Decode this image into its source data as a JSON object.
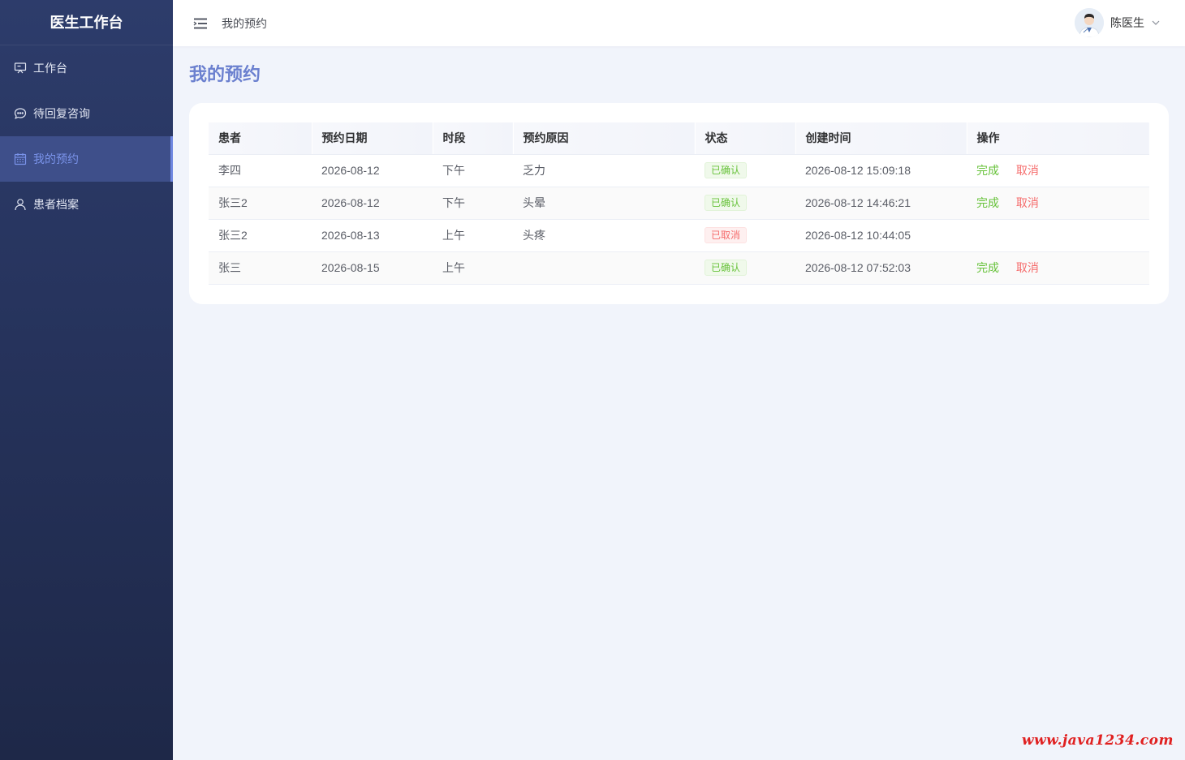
{
  "sidebar": {
    "brand": "医生工作台",
    "items": [
      {
        "label": "工作台",
        "icon": "presentation-board-icon",
        "active": false
      },
      {
        "label": "待回复咨询",
        "icon": "chat-bubble-icon",
        "active": false
      },
      {
        "label": "我的预约",
        "icon": "calendar-icon",
        "active": true
      },
      {
        "label": "患者档案",
        "icon": "user-icon",
        "active": false
      }
    ]
  },
  "header": {
    "breadcrumb": "我的预约",
    "user_name": "陈医生"
  },
  "page": {
    "title": "我的预约"
  },
  "table": {
    "columns": [
      "患者",
      "预约日期",
      "时段",
      "预约原因",
      "状态",
      "创建时间",
      "操作"
    ],
    "rows": [
      {
        "patient": "李四",
        "date": "2026-08-12",
        "slot": "下午",
        "reason": "乏力",
        "status": "已确认",
        "created": "2026-08-12 15:09:18",
        "actions": [
          "完成",
          "取消"
        ]
      },
      {
        "patient": "张三2",
        "date": "2026-08-12",
        "slot": "下午",
        "reason": "头晕",
        "status": "已确认",
        "created": "2026-08-12 14:46:21",
        "actions": [
          "完成",
          "取消"
        ]
      },
      {
        "patient": "张三2",
        "date": "2026-08-13",
        "slot": "上午",
        "reason": "头疼",
        "status": "已取消",
        "created": "2026-08-12 10:44:05",
        "actions": []
      },
      {
        "patient": "张三",
        "date": "2026-08-15",
        "slot": "上午",
        "reason": "",
        "status": "已确认",
        "created": "2026-08-12 07:52:03",
        "actions": [
          "完成",
          "取消"
        ]
      }
    ]
  },
  "watermark": "www.java1234.com",
  "colors": {
    "accent": "#6b80cf",
    "success": "#67c23a",
    "danger": "#f56c6c",
    "sidebar_bg": "#26335c"
  }
}
